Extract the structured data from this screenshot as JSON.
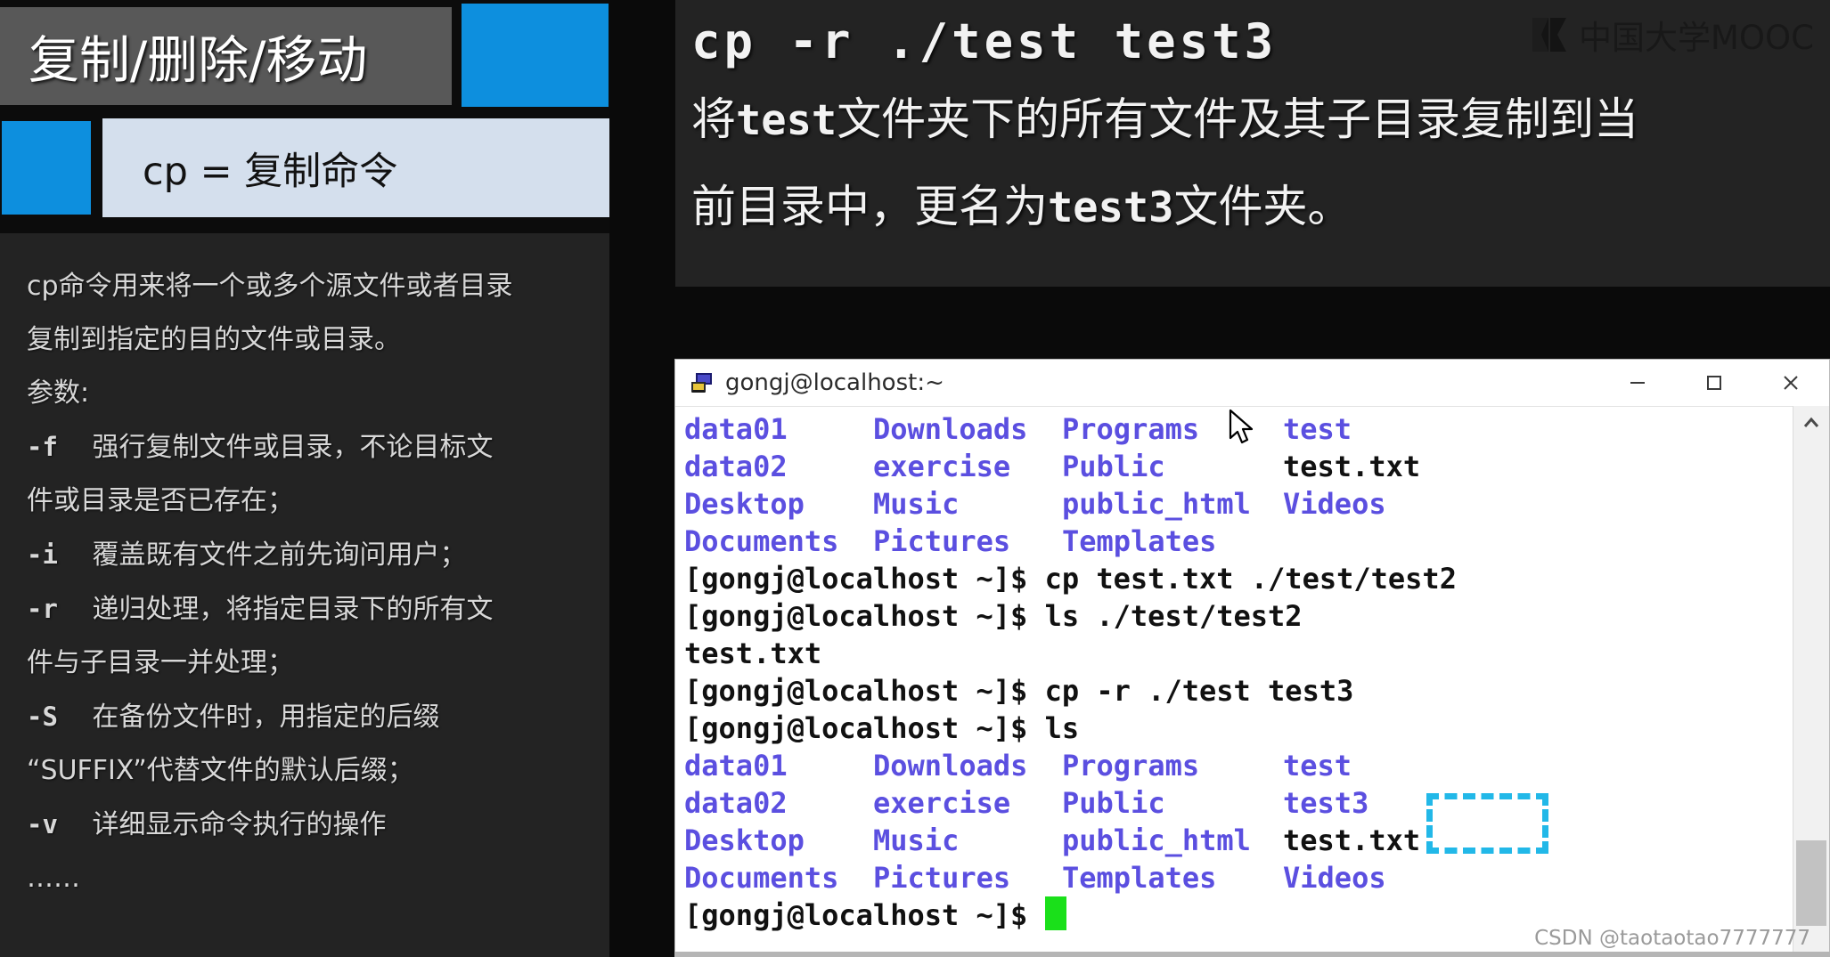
{
  "slide": {
    "title": "复制/删除/移动",
    "definition": "cp = 复制命令",
    "description_lines": [
      {
        "flag": "",
        "text": "cp命令用来将一个或多个源文件或者目录"
      },
      {
        "flag": "",
        "text": "复制到指定的目的文件或目录。"
      },
      {
        "flag": "",
        "text": "参数:"
      },
      {
        "flag": "-f",
        "text": "强行复制文件或目录，不论目标文"
      },
      {
        "flag": "",
        "text": "件或目录是否已存在；"
      },
      {
        "flag": "-i",
        "text": "覆盖既有文件之前先询问用户；"
      },
      {
        "flag": "-r",
        "text": "递归处理，将指定目录下的所有文"
      },
      {
        "flag": "",
        "text": "件与子目录一并处理；"
      },
      {
        "flag": "-S",
        "text": "在备份文件时，用指定的后缀"
      },
      {
        "flag": "",
        "text": "“SUFFIX”代替文件的默认后缀；"
      },
      {
        "flag": "-v",
        "text": "详细显示命令执行的操作"
      },
      {
        "flag": "",
        "text": "……"
      }
    ]
  },
  "command_card": {
    "command": "cp -r ./test test3",
    "desc_line_1_pre": "将",
    "desc_line_1_mono": "test",
    "desc_line_1_post": "文件夹下的所有文件及其子目录复制到当",
    "desc_line_2_pre": "前目录中，更名为",
    "desc_line_2_mono": "test3",
    "desc_line_2_post": "文件夹。"
  },
  "branding": {
    "logo_text": "中国大学MOOC",
    "watermark": "CSDN @taotaotao7777777"
  },
  "terminal": {
    "title": "gongj@localhost:~",
    "controls": {
      "minimize": "—",
      "maximize": "□",
      "close": "✕"
    },
    "prompt": "[gongj@localhost ~]$ ",
    "listing_1": [
      [
        "data01",
        "Downloads",
        "Programs",
        "test"
      ],
      [
        "data02",
        "exercise",
        "Public",
        "test.txt"
      ],
      [
        "Desktop",
        "Music",
        "public_html",
        "Videos"
      ],
      [
        "Documents",
        "Pictures",
        "Templates",
        ""
      ]
    ],
    "listing_1_types": [
      [
        "dir",
        "dir",
        "dir",
        "dir"
      ],
      [
        "dir",
        "dir",
        "dir",
        "file"
      ],
      [
        "dir",
        "dir",
        "dir",
        "dir"
      ],
      [
        "dir",
        "dir",
        "dir",
        ""
      ]
    ],
    "cmd_1": "cp test.txt ./test/test2",
    "cmd_2": "ls ./test/test2",
    "output_1": "test.txt",
    "cmd_3": "cp -r ./test test3",
    "cmd_4": "ls",
    "listing_2": [
      [
        "data01",
        "Downloads",
        "Programs",
        "test"
      ],
      [
        "data02",
        "exercise",
        "Public",
        "test3"
      ],
      [
        "Desktop",
        "Music",
        "public_html",
        "test.txt"
      ],
      [
        "Documents",
        "Pictures",
        "Templates",
        "Videos"
      ]
    ],
    "listing_2_types": [
      [
        "dir",
        "dir",
        "dir",
        "dir"
      ],
      [
        "dir",
        "dir",
        "dir",
        "dir"
      ],
      [
        "dir",
        "dir",
        "dir",
        "file"
      ],
      [
        "dir",
        "dir",
        "dir",
        "dir"
      ]
    ],
    "final_prompt": "[gongj@localhost ~]$ ",
    "highlighted_item": "test3"
  },
  "colors": {
    "accent_blue": "#0d8fde",
    "light_blue_box": "#d4dfed",
    "highlight_cyan": "#22b8e8",
    "dir_violet": "#5b4fe0",
    "cursor_green": "#1ae01a",
    "panel_gray": "#232323",
    "title_gray": "#585858"
  }
}
